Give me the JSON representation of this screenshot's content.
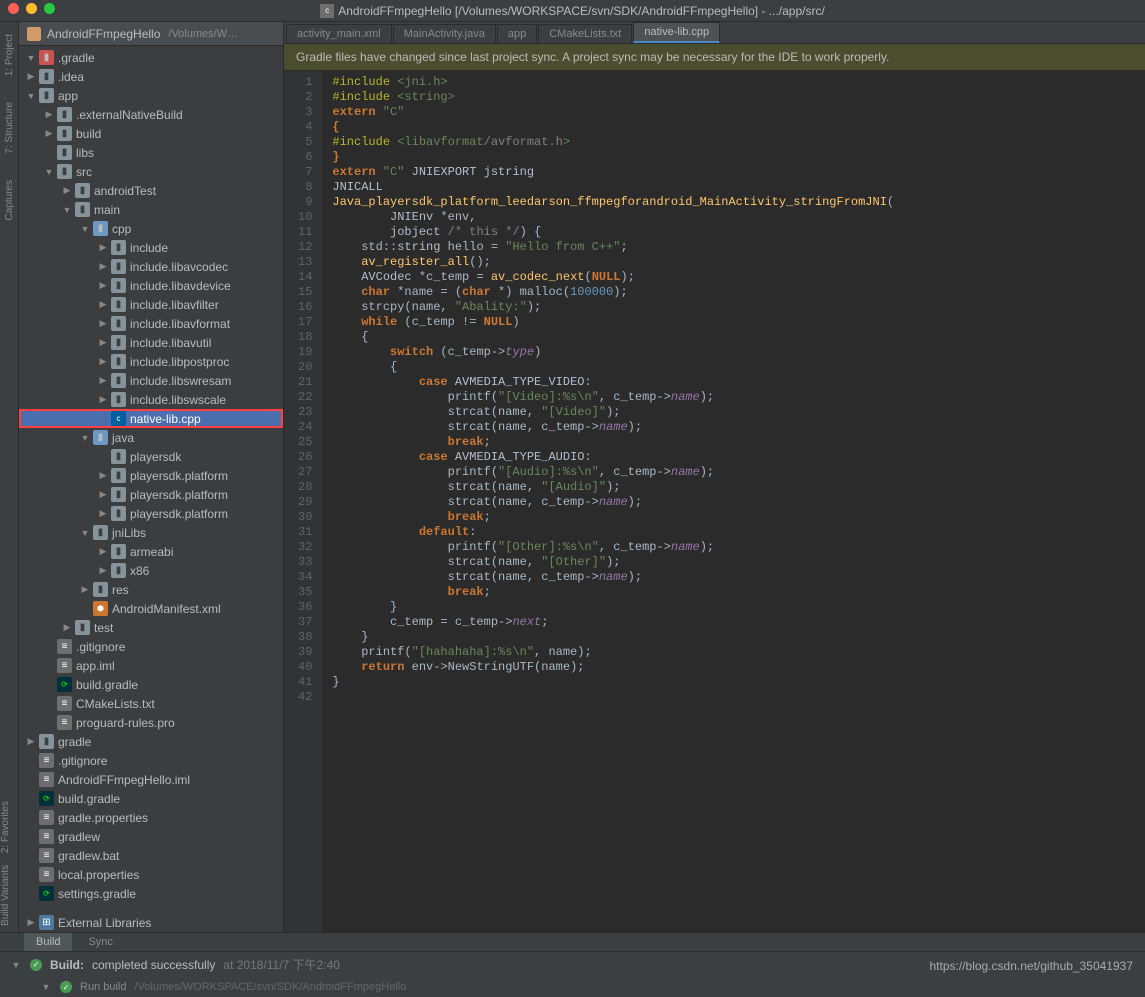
{
  "window": {
    "title": "AndroidFFmpegHello [/Volumes/WORKSPACE/svn/SDK/AndroidFFmpegHello] - .../app/src/"
  },
  "mac": {
    "close": "",
    "min": "",
    "max": ""
  },
  "leftRail": [
    "1: Project",
    "7: Structure",
    "Captures"
  ],
  "leftRail2": [
    "2: Favorites",
    "Build Variants"
  ],
  "sidebar": {
    "project": "AndroidFFmpegHello",
    "projectPath": "/Volumes/W…",
    "tree": [
      {
        "d": 0,
        "tw": "open",
        "icon": "folder-cfg",
        "label": ".gradle"
      },
      {
        "d": 0,
        "tw": "closed",
        "icon": "folder",
        "label": ".idea"
      },
      {
        "d": 0,
        "tw": "open",
        "icon": "folder",
        "label": "app"
      },
      {
        "d": 1,
        "tw": "closed",
        "icon": "folder",
        "label": ".externalNativeBuild"
      },
      {
        "d": 1,
        "tw": "closed",
        "icon": "folder",
        "label": "build"
      },
      {
        "d": 1,
        "tw": "none",
        "icon": "folder",
        "label": "libs"
      },
      {
        "d": 1,
        "tw": "open",
        "icon": "folder",
        "label": "src"
      },
      {
        "d": 2,
        "tw": "closed",
        "icon": "folder",
        "label": "androidTest"
      },
      {
        "d": 2,
        "tw": "open",
        "icon": "folder",
        "label": "main"
      },
      {
        "d": 3,
        "tw": "open",
        "icon": "folder-src",
        "label": "cpp"
      },
      {
        "d": 4,
        "tw": "closed",
        "icon": "folder",
        "label": "include"
      },
      {
        "d": 4,
        "tw": "closed",
        "icon": "folder",
        "label": "include.libavcodec"
      },
      {
        "d": 4,
        "tw": "closed",
        "icon": "folder",
        "label": "include.libavdevice"
      },
      {
        "d": 4,
        "tw": "closed",
        "icon": "folder",
        "label": "include.libavfilter"
      },
      {
        "d": 4,
        "tw": "closed",
        "icon": "folder",
        "label": "include.libavformat"
      },
      {
        "d": 4,
        "tw": "closed",
        "icon": "folder",
        "label": "include.libavutil"
      },
      {
        "d": 4,
        "tw": "closed",
        "icon": "folder",
        "label": "include.libpostproc"
      },
      {
        "d": 4,
        "tw": "closed",
        "icon": "folder",
        "label": "include.libswresam"
      },
      {
        "d": 4,
        "tw": "closed",
        "icon": "folder",
        "label": "include.libswscale"
      },
      {
        "d": 4,
        "tw": "none",
        "icon": "cpp",
        "label": "native-lib.cpp",
        "sel": true,
        "hl": true
      },
      {
        "d": 3,
        "tw": "open",
        "icon": "folder-src",
        "label": "java"
      },
      {
        "d": 4,
        "tw": "none",
        "icon": "folder",
        "label": "playersdk"
      },
      {
        "d": 4,
        "tw": "closed",
        "icon": "folder",
        "label": "playersdk.platform"
      },
      {
        "d": 4,
        "tw": "closed",
        "icon": "folder",
        "label": "playersdk.platform"
      },
      {
        "d": 4,
        "tw": "closed",
        "icon": "folder",
        "label": "playersdk.platform"
      },
      {
        "d": 3,
        "tw": "open",
        "icon": "folder",
        "label": "jniLibs"
      },
      {
        "d": 4,
        "tw": "closed",
        "icon": "folder",
        "label": "armeabi"
      },
      {
        "d": 4,
        "tw": "closed",
        "icon": "folder",
        "label": "x86"
      },
      {
        "d": 3,
        "tw": "closed",
        "icon": "folder",
        "label": "res"
      },
      {
        "d": 3,
        "tw": "none",
        "icon": "xml",
        "label": "AndroidManifest.xml"
      },
      {
        "d": 2,
        "tw": "closed",
        "icon": "folder",
        "label": "test"
      },
      {
        "d": 1,
        "tw": "none",
        "icon": "dot",
        "label": ".gitignore"
      },
      {
        "d": 1,
        "tw": "none",
        "icon": "file",
        "label": "app.iml"
      },
      {
        "d": 1,
        "tw": "none",
        "icon": "gradle",
        "label": "build.gradle"
      },
      {
        "d": 1,
        "tw": "none",
        "icon": "file",
        "label": "CMakeLists.txt"
      },
      {
        "d": 1,
        "tw": "none",
        "icon": "file",
        "label": "proguard-rules.pro"
      },
      {
        "d": 0,
        "tw": "closed",
        "icon": "folder",
        "label": "gradle"
      },
      {
        "d": 0,
        "tw": "none",
        "icon": "dot",
        "label": ".gitignore"
      },
      {
        "d": 0,
        "tw": "none",
        "icon": "file",
        "label": "AndroidFFmpegHello.iml"
      },
      {
        "d": 0,
        "tw": "none",
        "icon": "gradle",
        "label": "build.gradle"
      },
      {
        "d": 0,
        "tw": "none",
        "icon": "file",
        "label": "gradle.properties"
      },
      {
        "d": 0,
        "tw": "none",
        "icon": "file",
        "label": "gradlew"
      },
      {
        "d": 0,
        "tw": "none",
        "icon": "file",
        "label": "gradlew.bat"
      },
      {
        "d": 0,
        "tw": "none",
        "icon": "file",
        "label": "local.properties"
      },
      {
        "d": 0,
        "tw": "none",
        "icon": "gradle",
        "label": "settings.gradle"
      }
    ],
    "extLibs": "External Libraries"
  },
  "tabs": [
    {
      "label": "activity_main.xml",
      "active": false
    },
    {
      "label": "MainActivity.java",
      "active": false
    },
    {
      "label": "app",
      "active": false
    },
    {
      "label": "CMakeLists.txt",
      "active": false
    },
    {
      "label": "native-lib.cpp",
      "active": true
    }
  ],
  "notification": "Gradle files have changed since last project sync. A project sync may be necessary for the IDE to work properly.",
  "code": {
    "lines": [
      "<span class='pp'>#include</span> <span class='inc'>&lt;jni.h&gt;</span>",
      "<span class='pp'>#include</span> <span class='inc'>&lt;string&gt;</span>",
      "<span class='kw'>extern</span> <span class='str'>\"C\"</span>",
      "<span class='kw'>{</span>",
      "<span class='pp'>#include</span> <span class='inc'>&lt;libavformat</span><span class='incpath'>/avformat.h</span><span class='inc'>&gt;</span>",
      "<span class='kw'>}</span>",
      "<span class='kw'>extern</span> <span class='str'>\"C\"</span> <span class='ty'>JNIEXPORT</span> <span class='ty'>jstring</span>",
      "<span class='ty'>JNICALL</span>",
      "<span class='fn'>Java_playersdk_platform_leedarson_ffmpegforandroid_MainActivity_stringFromJNI</span>(",
      "        <span class='ty'>JNIEnv</span> *env,",
      "        <span class='ty'>jobject</span> <span class='com'>/* this */</span>) {",
      "    std::<span class='ty'>string</span> hello = <span class='str'>\"Hello from C++\"</span>;",
      "    <span class='fn'>av_register_all</span>();",
      "    <span class='ty'>AVCodec</span> *c_temp = <span class='fn'>av_codec_next</span>(<span class='kw'>NULL</span>);",
      "    <span class='kw'>char</span> *name = (<span class='kw'>char</span> *) malloc(<span class='num'>100000</span>);",
      "    strcpy(name, <span class='str'>\"Abality:\"</span>);",
      "    <span class='kw'>while</span> (c_temp != <span class='kw'>NULL</span>)",
      "    {",
      "        <span class='kw'>switch</span> (c_temp-&gt;<span class='mem'>type</span>)",
      "        {",
      "            <span class='kw'>case</span> <span class='ty'>AVMEDIA_TYPE_VIDEO</span>:",
      "                printf(<span class='str'>\"[Video]:%s\\n\"</span>, c_temp-&gt;<span class='mem'>name</span>);",
      "                strcat(name, <span class='str'>\"[Video]\"</span>);",
      "                strcat(name, c_temp-&gt;<span class='mem'>name</span>);",
      "                <span class='kw'>break</span>;",
      "            <span class='kw'>case</span> <span class='ty'>AVMEDIA_TYPE_AUDIO</span>:",
      "                printf(<span class='str'>\"[Audio]:%s\\n\"</span>, c_temp-&gt;<span class='mem'>name</span>);",
      "                strcat(name, <span class='str'>\"[Audio]\"</span>);",
      "                strcat(name, c_temp-&gt;<span class='mem'>name</span>);",
      "                <span class='kw'>break</span>;",
      "            <span class='kw'>default</span>:",
      "                printf(<span class='str'>\"[Other]:%s\\n\"</span>, c_temp-&gt;<span class='mem'>name</span>);",
      "                strcat(name, <span class='str'>\"[Other]\"</span>);",
      "                strcat(name, c_temp-&gt;<span class='mem'>name</span>);",
      "                <span class='kw'>break</span>;",
      "        }",
      "        c_temp = c_temp-&gt;<span class='mem'>next</span>;",
      "    }",
      "    printf(<span class='str'>\"[hahahaha]:%s\\n\"</span>, name);",
      "    <span class='kw'>return</span> env-&gt;NewStringUTF(name);",
      "}",
      ""
    ]
  },
  "bottom": {
    "tabs": [
      "Build",
      "Sync"
    ],
    "activeTab": 0,
    "buildTitle": "Build:",
    "buildStatus": "completed successfully",
    "buildTime": "at 2018/11/7 下午2:40",
    "runBuild": "Run build",
    "runPath": "/Volumes/WORKSPACE/svn/SDK/AndroidFFmpegHello"
  },
  "watermark": "https://blog.csdn.net/github_35041937"
}
